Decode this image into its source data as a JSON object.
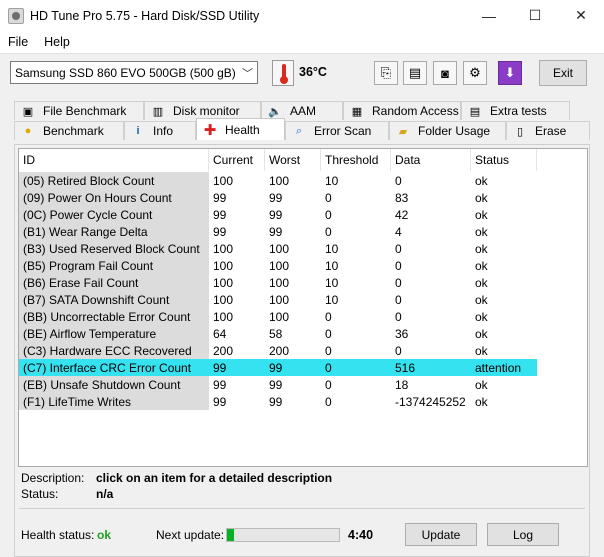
{
  "window": {
    "title": "HD Tune Pro 5.75 - Hard Disk/SSD Utility",
    "minimize": "—",
    "maximize": "☐",
    "close": "✕"
  },
  "menu": [
    {
      "label": "File"
    },
    {
      "label": "Help"
    }
  ],
  "toolbar": {
    "drive": "Samsung SSD 860 EVO 500GB (500 gB)",
    "temperature": "36°C",
    "exit_label": "Exit"
  },
  "tabs_top": [
    {
      "label": "File Benchmark",
      "icon": "file-benchmark-icon"
    },
    {
      "label": "Disk monitor",
      "icon": "disk-monitor-icon"
    },
    {
      "label": "AAM",
      "icon": "speaker-icon"
    },
    {
      "label": "Random Access",
      "icon": "random-access-icon"
    },
    {
      "label": "Extra tests",
      "icon": "extra-tests-icon"
    }
  ],
  "tabs_bottom": [
    {
      "label": "Benchmark",
      "icon": "bulb-icon"
    },
    {
      "label": "Info",
      "icon": "info-icon"
    },
    {
      "label": "Health",
      "icon": "health-cross-icon"
    },
    {
      "label": "Error Scan",
      "icon": "magnifier-icon"
    },
    {
      "label": "Folder Usage",
      "icon": "folder-icon"
    },
    {
      "label": "Erase",
      "icon": "trash-icon"
    }
  ],
  "active_tab": "Health",
  "table": {
    "columns": [
      "ID",
      "Current",
      "Worst",
      "Threshold",
      "Data",
      "Status"
    ],
    "rows": [
      {
        "id": "(05) Retired Block Count",
        "current": "100",
        "worst": "100",
        "threshold": "10",
        "data": "0",
        "status": "ok"
      },
      {
        "id": "(09) Power On Hours Count",
        "current": "99",
        "worst": "99",
        "threshold": "0",
        "data": "83",
        "status": "ok"
      },
      {
        "id": "(0C) Power Cycle Count",
        "current": "99",
        "worst": "99",
        "threshold": "0",
        "data": "42",
        "status": "ok"
      },
      {
        "id": "(B1) Wear Range Delta",
        "current": "99",
        "worst": "99",
        "threshold": "0",
        "data": "4",
        "status": "ok"
      },
      {
        "id": "(B3) Used Reserved Block Count",
        "current": "100",
        "worst": "100",
        "threshold": "10",
        "data": "0",
        "status": "ok"
      },
      {
        "id": "(B5) Program Fail Count",
        "current": "100",
        "worst": "100",
        "threshold": "10",
        "data": "0",
        "status": "ok"
      },
      {
        "id": "(B6) Erase Fail Count",
        "current": "100",
        "worst": "100",
        "threshold": "10",
        "data": "0",
        "status": "ok"
      },
      {
        "id": "(B7) SATA Downshift Count",
        "current": "100",
        "worst": "100",
        "threshold": "10",
        "data": "0",
        "status": "ok"
      },
      {
        "id": "(BB) Uncorrectable Error Count",
        "current": "100",
        "worst": "100",
        "threshold": "0",
        "data": "0",
        "status": "ok"
      },
      {
        "id": "(BE) Airflow Temperature",
        "current": "64",
        "worst": "58",
        "threshold": "0",
        "data": "36",
        "status": "ok"
      },
      {
        "id": "(C3) Hardware ECC Recovered",
        "current": "200",
        "worst": "200",
        "threshold": "0",
        "data": "0",
        "status": "ok"
      },
      {
        "id": "(C7) Interface CRC Error Count",
        "current": "99",
        "worst": "99",
        "threshold": "0",
        "data": "516",
        "status": "attention"
      },
      {
        "id": "(EB) Unsafe Shutdown Count",
        "current": "99",
        "worst": "99",
        "threshold": "0",
        "data": "18",
        "status": "ok"
      },
      {
        "id": "(F1) LifeTime Writes",
        "current": "99",
        "worst": "99",
        "threshold": "0",
        "data": "-1374245252",
        "status": "ok"
      }
    ],
    "selected_index": 11
  },
  "details": {
    "description_label": "Description:",
    "description_value": "click on an item for a detailed description",
    "status_label": "Status:",
    "status_value": "n/a"
  },
  "footer": {
    "health_label": "Health status:",
    "health_value": "ok",
    "next_update_label": "Next update:",
    "progress_fraction": 0.06,
    "countdown": "4:40",
    "update_label": "Update",
    "log_label": "Log"
  },
  "colors": {
    "selected_row": "#35e2ef",
    "health_ok": "#1fa01f",
    "progress_fill": "#06b025"
  }
}
